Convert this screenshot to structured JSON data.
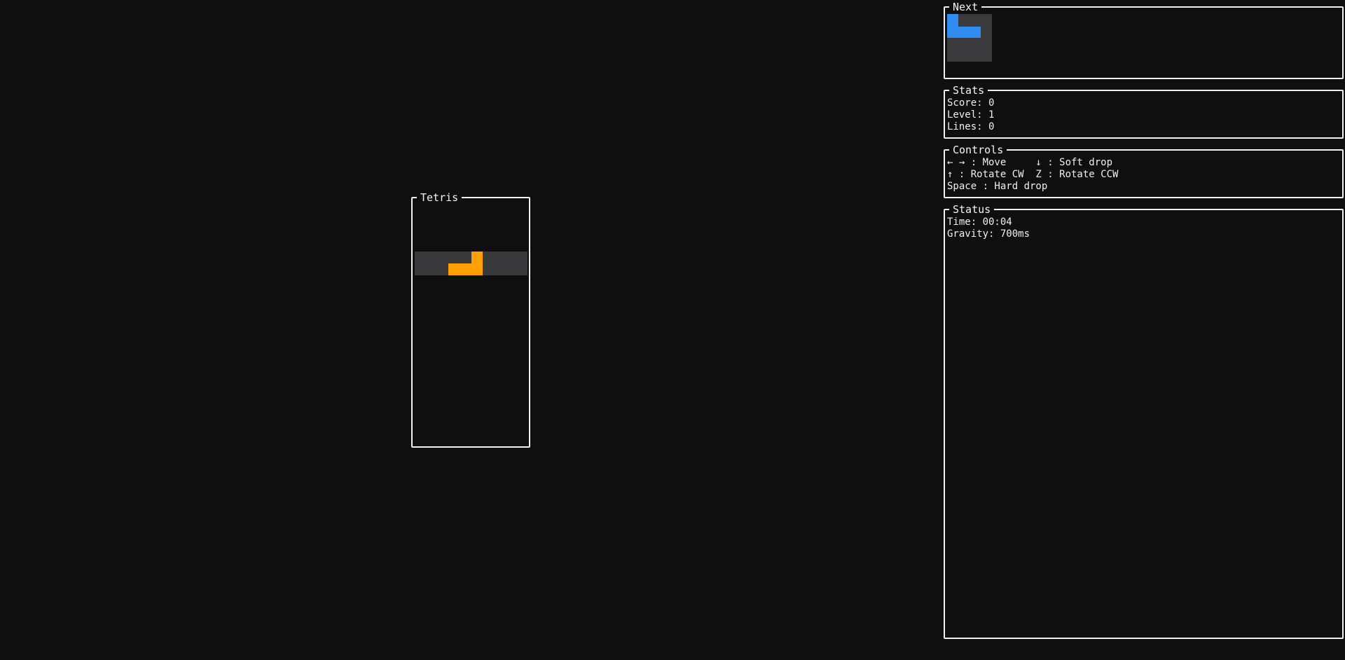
{
  "board": {
    "title": "Tetris",
    "active_piece": {
      "type": "L",
      "color": "#ffa105",
      "cells": [
        [
          2,
          1
        ],
        [
          3,
          1
        ],
        [
          3,
          0
        ],
        [
          4,
          1
        ]
      ]
    }
  },
  "next": {
    "title": "Next",
    "piece": {
      "type": "J",
      "color": "#2f8cf2"
    }
  },
  "stats": {
    "title": "Stats",
    "score": "Score: 0",
    "level": "Level: 1",
    "lines": "Lines: 0"
  },
  "controls": {
    "title": "Controls",
    "line1": "← → : Move     ↓ : Soft drop",
    "line2": "↑ : Rotate CW  Z : Rotate CCW",
    "line3": "Space : Hard drop"
  },
  "status": {
    "title": "Status",
    "time": "Time: 00:04",
    "gravity": "Gravity: 700ms"
  },
  "colors": {
    "background": "#0f0f10",
    "border": "#f2f2f2",
    "empty_row": "#39393b",
    "l_piece": "#ffa105",
    "j_piece": "#2f8cf2"
  }
}
